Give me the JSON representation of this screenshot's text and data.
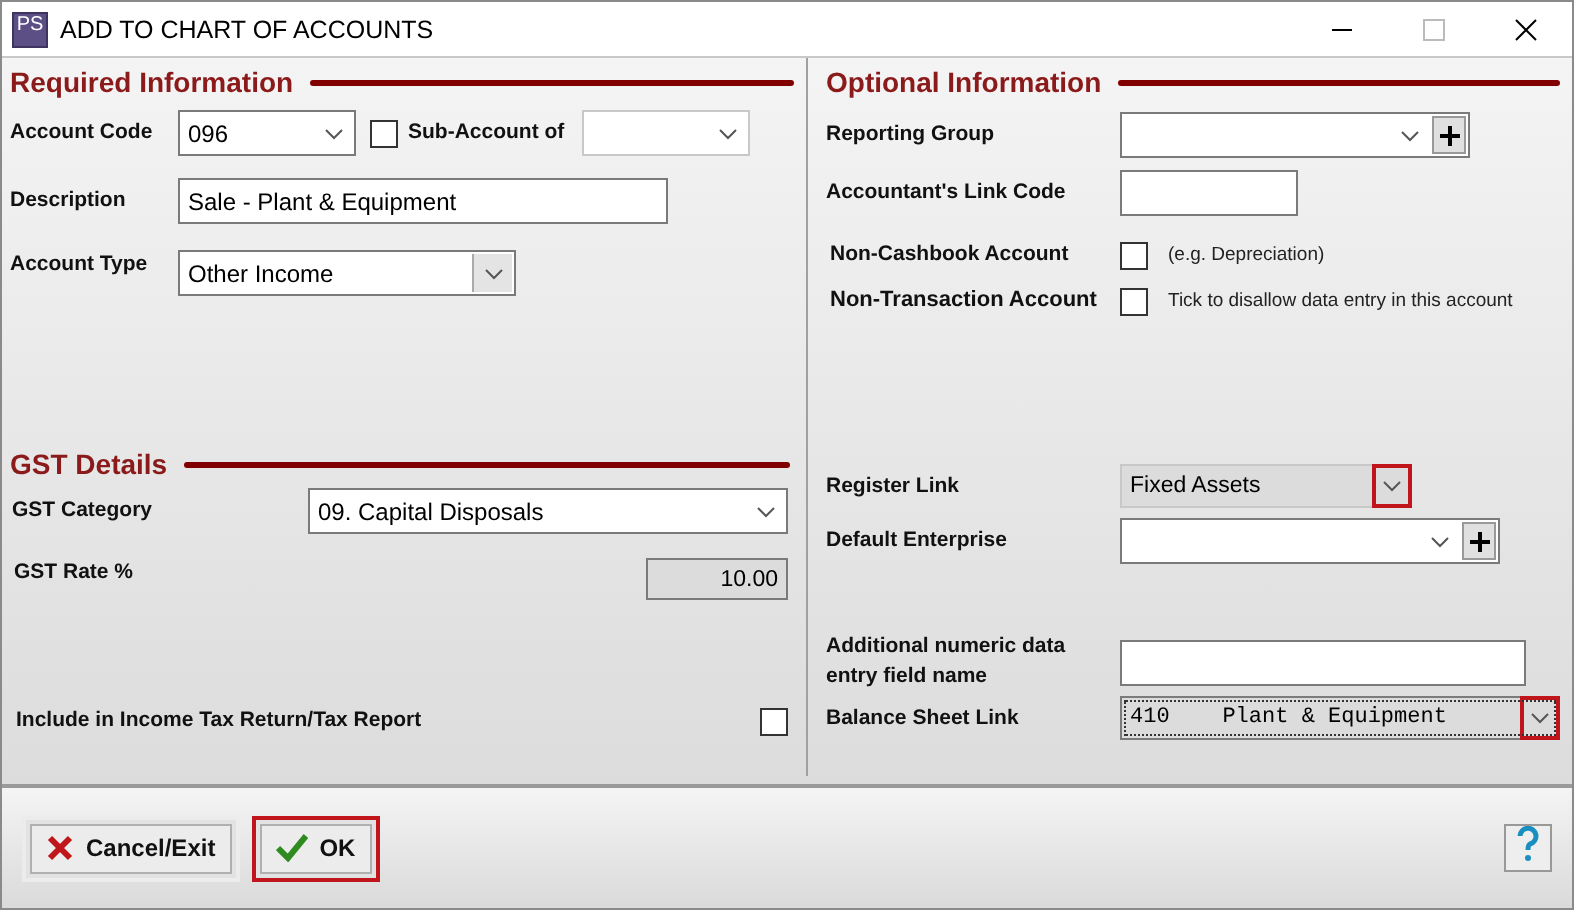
{
  "window": {
    "title": "ADD TO CHART OF ACCOUNTS",
    "app_icon": "PS"
  },
  "required": {
    "heading": "Required Information",
    "account_code": {
      "label": "Account Code",
      "value": "096"
    },
    "sub_account": {
      "label": "Sub-Account of",
      "checked": false
    },
    "description": {
      "label": "Description",
      "value": "Sale - Plant & Equipment"
    },
    "account_type": {
      "label": "Account Type",
      "value": "Other Income"
    }
  },
  "gst": {
    "heading": "GST Details",
    "category": {
      "label": "GST Category",
      "value": "09. Capital Disposals"
    },
    "rate": {
      "label": "GST Rate %",
      "value": "10.00",
      "readonly": true
    },
    "include_tax": {
      "label": "Include in Income Tax Return/Tax Report",
      "checked": false
    }
  },
  "optional": {
    "heading": "Optional Information",
    "reporting_group": {
      "label": "Reporting Group"
    },
    "link_code": {
      "label": "Accountant's Link Code"
    },
    "non_cashbook": {
      "label": "Non-Cashbook Account",
      "checked": false,
      "note": "(e.g. Depreciation)"
    },
    "non_transaction": {
      "label": "Non-Transaction Account",
      "checked": false,
      "note": "Tick to disallow data entry in this account"
    },
    "register_link": {
      "label": "Register Link",
      "value": "Fixed Assets",
      "highlighted": true
    },
    "default_enterprise": {
      "label": "Default Enterprise"
    },
    "additional_field": {
      "label": "Additional numeric data entry field name"
    },
    "balance_sheet_link": {
      "label": "Balance Sheet Link",
      "code": "410",
      "value": "Plant & Equipment",
      "highlighted": true
    }
  },
  "buttons": [
    {
      "kind": "cancel",
      "label": "Cancel/Exit",
      "highlighted": false
    },
    {
      "kind": "ok",
      "label": "OK",
      "highlighted": true
    }
  ]
}
